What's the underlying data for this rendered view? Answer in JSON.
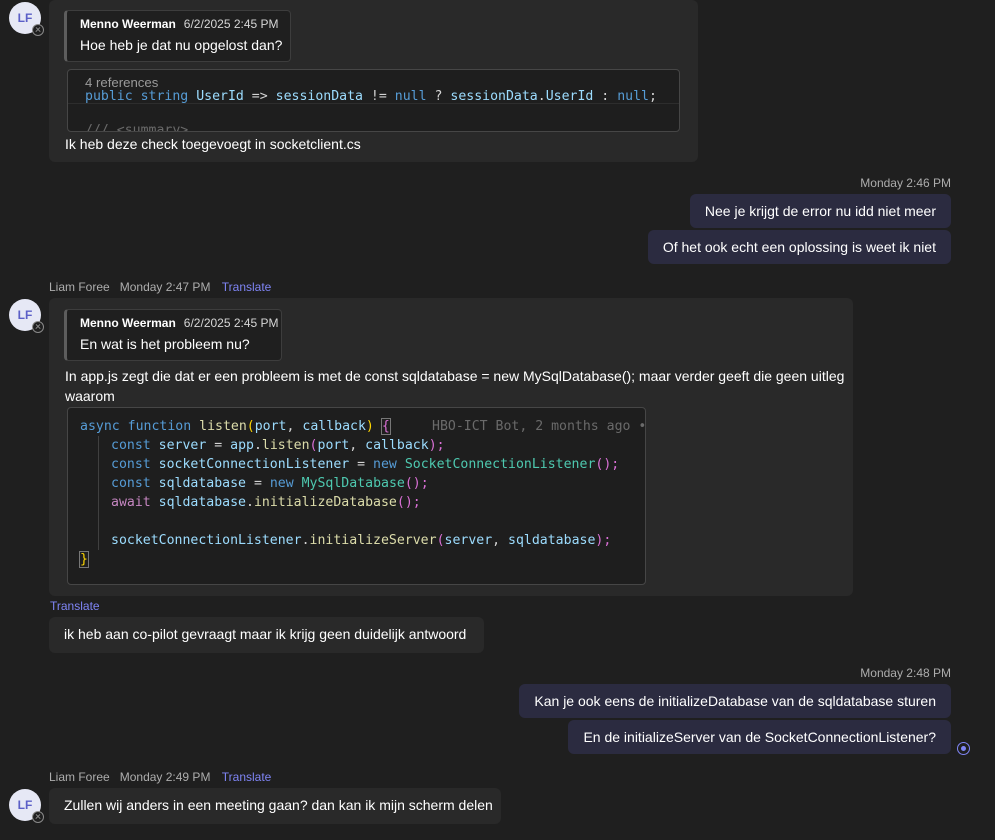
{
  "avatar_initials": "LF",
  "messages": {
    "m1": {
      "quote_author": "Menno Weerman",
      "quote_time": "6/2/2025 2:45 PM",
      "quote_text": "Hoe heb je dat nu opgelost dan?",
      "code_refs": "4 references",
      "code_tokens": [
        "public",
        "string",
        "UserId",
        "=>",
        "sessionData",
        "!=",
        "null",
        "?",
        "sessionData",
        ".",
        "UserId",
        ":",
        "null",
        ";"
      ],
      "code_cut": "/// <summary>",
      "text": "Ik heb deze check toegevoegt in socketclient.cs"
    },
    "out1": {
      "time": "Monday 2:46 PM",
      "lines": [
        "Nee je krijgt de error nu idd niet meer",
        "Of het ook echt een oplossing is weet ik niet"
      ]
    },
    "m2": {
      "author": "Liam Foree",
      "time": "Monday 2:47 PM",
      "translate": "Translate",
      "quote_author": "Menno Weerman",
      "quote_time": "6/2/2025 2:45 PM",
      "quote_text": "En wat is het probleem nu?",
      "text_line1": "In app.js zegt die dat er een probleem is met de const sqldatabase = new MySqlDatabase(); maar verder geeft die geen uitleg",
      "text_line2": "waarom",
      "code": {
        "l1": [
          "async",
          "function",
          "listen",
          "(",
          "port",
          ", ",
          "callback",
          ")",
          " ",
          "{"
        ],
        "ghost": "HBO-ICT Bot, 2 months ago •",
        "l2": [
          "const",
          "server",
          " = ",
          "app",
          ".",
          "listen",
          "(",
          "port",
          ", ",
          "callback",
          ");"
        ],
        "l3": [
          "const",
          "socketConnectionListener",
          " = ",
          "new",
          "SocketConnectionListener",
          "();"
        ],
        "l4": [
          "const",
          "sqldatabase",
          " = ",
          "new",
          "MySqlDatabase",
          "();"
        ],
        "l5": [
          "await",
          "sqldatabase",
          ".",
          "initializeDatabase",
          "();"
        ],
        "l6": [
          "socketConnectionListener",
          ".",
          "initializeServer",
          "(",
          "server",
          ", ",
          "sqldatabase",
          ");"
        ],
        "l7": "}"
      }
    },
    "m3": {
      "translate": "Translate",
      "text": "ik heb aan co-pilot gevraagt maar ik krijg geen duidelijk antwoord"
    },
    "out2": {
      "time": "Monday 2:48 PM",
      "lines": [
        "Kan je ook eens de initializeDatabase van de sqldatabase sturen",
        "En de initializeServer van de SocketConnectionListener?"
      ]
    },
    "m4": {
      "author": "Liam Foree",
      "time": "Monday 2:49 PM",
      "translate": "Translate",
      "text": "Zullen wij anders in een meeting gaan? dan kan ik mijn scherm delen"
    }
  },
  "colors": {
    "background": "#1f1f1f",
    "incoming_bubble": "#292929",
    "outgoing_bubble": "#2b2b40",
    "accent": "#7f85f5"
  }
}
